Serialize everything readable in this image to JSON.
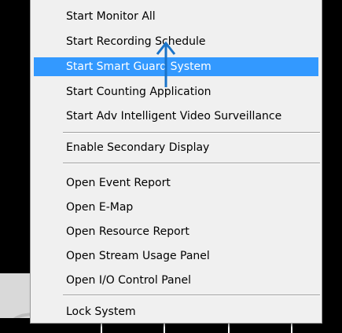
{
  "menu": {
    "items": [
      {
        "label": "Start Monitor All"
      },
      {
        "label": "Start Recording Schedule"
      },
      {
        "label": "Start Smart Guard System"
      },
      {
        "label": "Start Counting Application"
      },
      {
        "label": "Start Adv Intelligent Video Surveillance"
      },
      {
        "label": "Enable Secondary Display"
      },
      {
        "label": "Open Event Report"
      },
      {
        "label": "Open E-Map"
      },
      {
        "label": "Open Resource Report"
      },
      {
        "label": "Open Stream Usage Panel"
      },
      {
        "label": "Open I/O Control Panel"
      },
      {
        "label": "Lock System"
      }
    ],
    "highlighted_item": "Start Smart Guard System"
  },
  "colors": {
    "menu_background": "#f0f0f0",
    "highlight": "#3399ff",
    "highlight_text": "#ffffff",
    "annotation_arrow": "#1a73c8"
  },
  "annotation": {
    "icon": "up-arrow-icon"
  }
}
